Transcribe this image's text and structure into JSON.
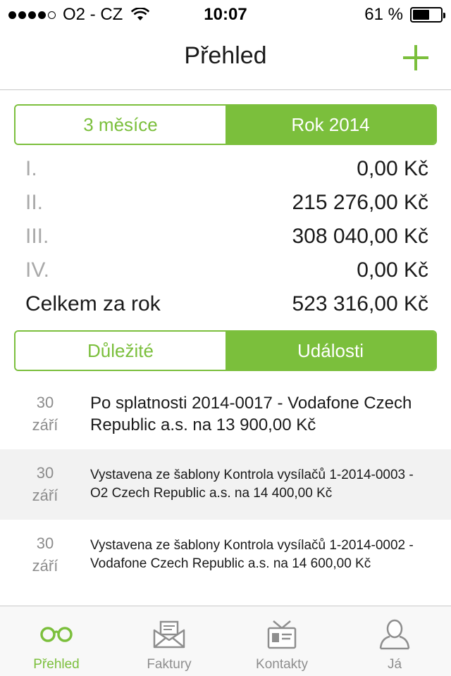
{
  "status_bar": {
    "carrier": "O2 - CZ",
    "time": "10:07",
    "battery": "61 %",
    "battery_level": 0.61,
    "signal_bars_filled": 4,
    "signal_bars_total": 5
  },
  "nav": {
    "title": "Přehled"
  },
  "period_toggle": {
    "options": [
      "3 měsíce",
      "Rok 2014"
    ],
    "selected": "Rok 2014"
  },
  "quarters": [
    {
      "label": "I.",
      "value": "0,00 Kč"
    },
    {
      "label": "II.",
      "value": "215 276,00 Kč"
    },
    {
      "label": "III.",
      "value": "308 040,00 Kč"
    },
    {
      "label": "IV.",
      "value": "0,00 Kč"
    }
  ],
  "total": {
    "label": "Celkem za rok",
    "value": "523 316,00 Kč"
  },
  "list_toggle": {
    "options": [
      "Důležité",
      "Události"
    ],
    "selected": "Události"
  },
  "events": [
    {
      "day": "30",
      "month": "září",
      "text": "Po splatnosti 2014-0017 - Vodafone Czech Republic a.s. na 13 900,00 Kč"
    },
    {
      "day": "30",
      "month": "září",
      "text": "Vystavena ze šablony Kontrola vysílačů 1-2014-0003 - O2 Czech Republic a.s. na 14 400,00 Kč"
    },
    {
      "day": "30",
      "month": "září",
      "text": "Vystavena ze šablony Kontrola vysílačů 1-2014-0002 - Vodafone Czech Republic a.s. na 14 600,00 Kč"
    }
  ],
  "tabs": [
    {
      "label": "Přehled",
      "icon": "glasses-icon",
      "active": true
    },
    {
      "label": "Faktury",
      "icon": "envelope-icon",
      "active": false
    },
    {
      "label": "Kontakty",
      "icon": "contact-card-icon",
      "active": false
    },
    {
      "label": "Já",
      "icon": "person-icon",
      "active": false
    }
  ],
  "colors": {
    "accent": "#7bbf3c",
    "muted": "#a9a9a9",
    "shaded_row": "#f2f2f2"
  }
}
